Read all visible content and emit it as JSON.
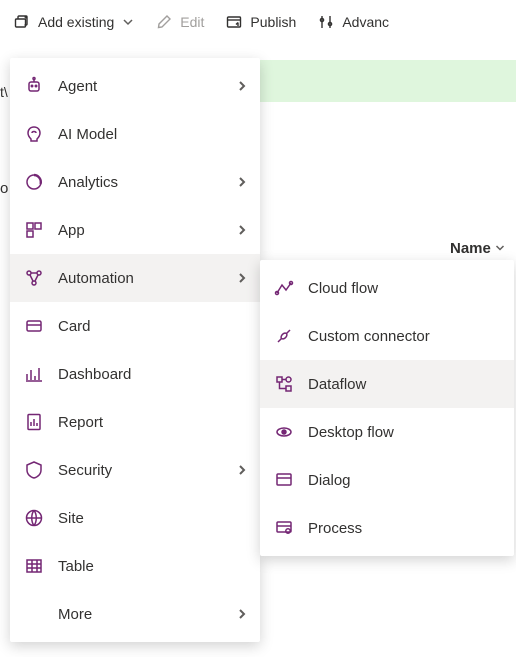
{
  "toolbar": {
    "add_existing": "Add existing",
    "edit": "Edit",
    "publish": "Publish",
    "advanced": "Advanc"
  },
  "column_header": "Name",
  "side_text1": "t\\",
  "side_text2": "o",
  "menu": {
    "items": [
      {
        "label": "Agent",
        "has_submenu": true
      },
      {
        "label": "AI Model",
        "has_submenu": false
      },
      {
        "label": "Analytics",
        "has_submenu": true
      },
      {
        "label": "App",
        "has_submenu": true
      },
      {
        "label": "Automation",
        "has_submenu": true
      },
      {
        "label": "Card",
        "has_submenu": false
      },
      {
        "label": "Dashboard",
        "has_submenu": false
      },
      {
        "label": "Report",
        "has_submenu": false
      },
      {
        "label": "Security",
        "has_submenu": true
      },
      {
        "label": "Site",
        "has_submenu": false
      },
      {
        "label": "Table",
        "has_submenu": false
      },
      {
        "label": "More",
        "has_submenu": true
      }
    ]
  },
  "submenu": {
    "items": [
      {
        "label": "Cloud flow"
      },
      {
        "label": "Custom connector"
      },
      {
        "label": "Dataflow"
      },
      {
        "label": "Desktop flow"
      },
      {
        "label": "Dialog"
      },
      {
        "label": "Process"
      }
    ]
  }
}
